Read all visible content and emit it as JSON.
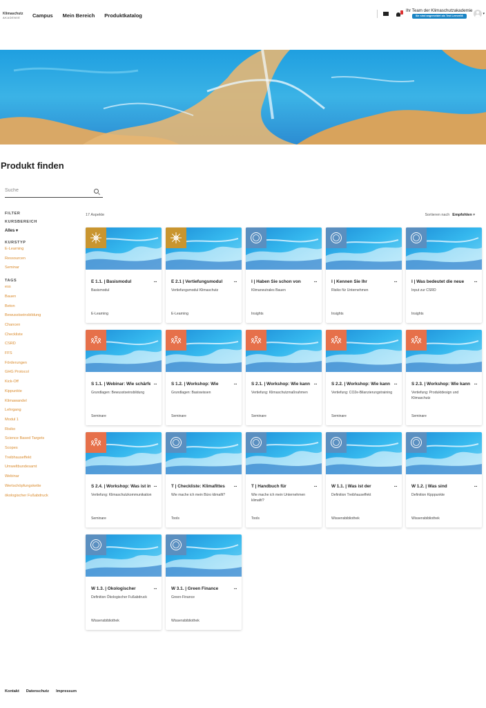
{
  "header": {
    "logo_line1": "Klimaschutz",
    "logo_line2": "AKADEMIE",
    "nav": [
      "Campus",
      "Mein Bereich",
      "Produktkatalog"
    ],
    "team_text": "Ihr Team der Klimaschutzakademie",
    "login_badge": "Sie sind angemeldet als Test Lerner08"
  },
  "page_title": "Produkt finden",
  "search": {
    "placeholder": "Suche"
  },
  "filter": {
    "heading": "FILTER",
    "kursbereich_heading": "KURSBEREICH",
    "kursbereich_value": "Alles",
    "kurstyp_heading": "KURSTYP",
    "kurstyp_items": [
      "E-Learning",
      "Ressourcen",
      "Seminar"
    ],
    "tags_heading": "TAGS",
    "tags": [
      "ess",
      "Bauen",
      "Beton",
      "Bewusstseinsbildung",
      "Chancen",
      "Checkliste",
      "CSRD",
      "FFS",
      "Förderungen",
      "GHG Protocol",
      "Kick-Off",
      "Kippunkte",
      "Klimawandel",
      "Lehrgang",
      "Modul 1",
      "Risiko",
      "Science Based Targets",
      "Scopes",
      "Treibhauseffekt",
      "Umweltbundesamt",
      "Webinar",
      "Wertschöpfungskette",
      "ökologischer Fußabdruck"
    ]
  },
  "toolbar": {
    "count": "17 Aspekte",
    "sort_label": "Sortieren nach",
    "sort_value": "Empfohlen"
  },
  "cards": [
    {
      "title": "E 1.1. | Basismodul",
      "desc": "Basismodul",
      "type": "E-Learning",
      "icon": "wheel-icon",
      "color": "#c9952f"
    },
    {
      "title": "E 2.1 | Vertiefungsmodul",
      "desc": "Vertiefungsmodul Klimaschutz",
      "type": "E-Learning",
      "icon": "wheel-icon",
      "color": "#c9952f"
    },
    {
      "title": "I | Haben Sie schon von",
      "desc": "Klimaneutrales Bauen",
      "type": "Insights",
      "icon": "compass-icon",
      "color": "#5a8fc0"
    },
    {
      "title": "I | Kennen Sie Ihr",
      "desc": "Risiko für Unternehmen",
      "type": "Insights",
      "icon": "compass-icon",
      "color": "#5a8fc0"
    },
    {
      "title": "I | Was bedeutet die neue",
      "desc": "Input zur CSRD",
      "type": "Insights",
      "icon": "compass-icon",
      "color": "#5a8fc0"
    },
    {
      "title": "S 1.1. | Webinar: Wie schärfe",
      "desc": "Grundlagen: Bewusstseinsbildung",
      "type": "Seminare",
      "icon": "people-icon",
      "color": "#e6704a"
    },
    {
      "title": "S 1.2. | Workshop: Wie",
      "desc": "Grundlagen: Basiswissen",
      "type": "Seminare",
      "icon": "people-icon",
      "color": "#e6704a"
    },
    {
      "title": "S 2.1. | Workshop: Wie kann",
      "desc": "Vertiefung: Klimaschutzmaßnahmen",
      "type": "Seminare",
      "icon": "people-icon",
      "color": "#e6704a"
    },
    {
      "title": "S 2.2. | Workshop: Wie kann",
      "desc": "Vertiefung: CO2e-Bilanzierungstraining",
      "type": "Seminare",
      "icon": "people-icon",
      "color": "#e6704a"
    },
    {
      "title": "S 2.3. | Workshop: Wie kann",
      "desc": "Vertiefung: Produktdesign und Klimaschutz",
      "type": "Seminare",
      "icon": "people-icon",
      "color": "#e6704a"
    },
    {
      "title": "S 2.4. | Workshop: Was ist in",
      "desc": "Vertiefung: Klimaschutzkommunikation",
      "type": "Seminare",
      "icon": "people-icon",
      "color": "#e6704a"
    },
    {
      "title": "T | Checkliste: Klimafittes",
      "desc": "Wie mache ich mein Büro klimafit?",
      "type": "Tools",
      "icon": "compass-icon",
      "color": "#5a8fc0"
    },
    {
      "title": "T | Handbuch für",
      "desc": "Wie mache ich mein Unternehmen klimafit?",
      "type": "Tools",
      "icon": "compass-icon",
      "color": "#5a8fc0"
    },
    {
      "title": "W 1.1. | Was ist der",
      "desc": "Definition Treibhauseffekt",
      "type": "Wissensbibliothek",
      "icon": "compass-icon",
      "color": "#5a8fc0"
    },
    {
      "title": "W 1.2. | Was sind",
      "desc": "Definition Kipppunkte",
      "type": "Wissensbibliothek",
      "icon": "compass-icon",
      "color": "#5a8fc0"
    },
    {
      "title": "W 1.3. | Ökologischer",
      "desc": "Definition Ökologischer Fußabdruck",
      "type": "Wissensbibliothek",
      "icon": "compass-icon",
      "color": "#5a8fc0"
    },
    {
      "title": "W 3.1. | Green Finance",
      "desc": "Green-Finance",
      "type": "Wissensbibliothek",
      "icon": "compass-icon",
      "color": "#5a8fc0"
    }
  ],
  "footer": [
    "Kontakt",
    "Datenschutz",
    "Impressum"
  ]
}
